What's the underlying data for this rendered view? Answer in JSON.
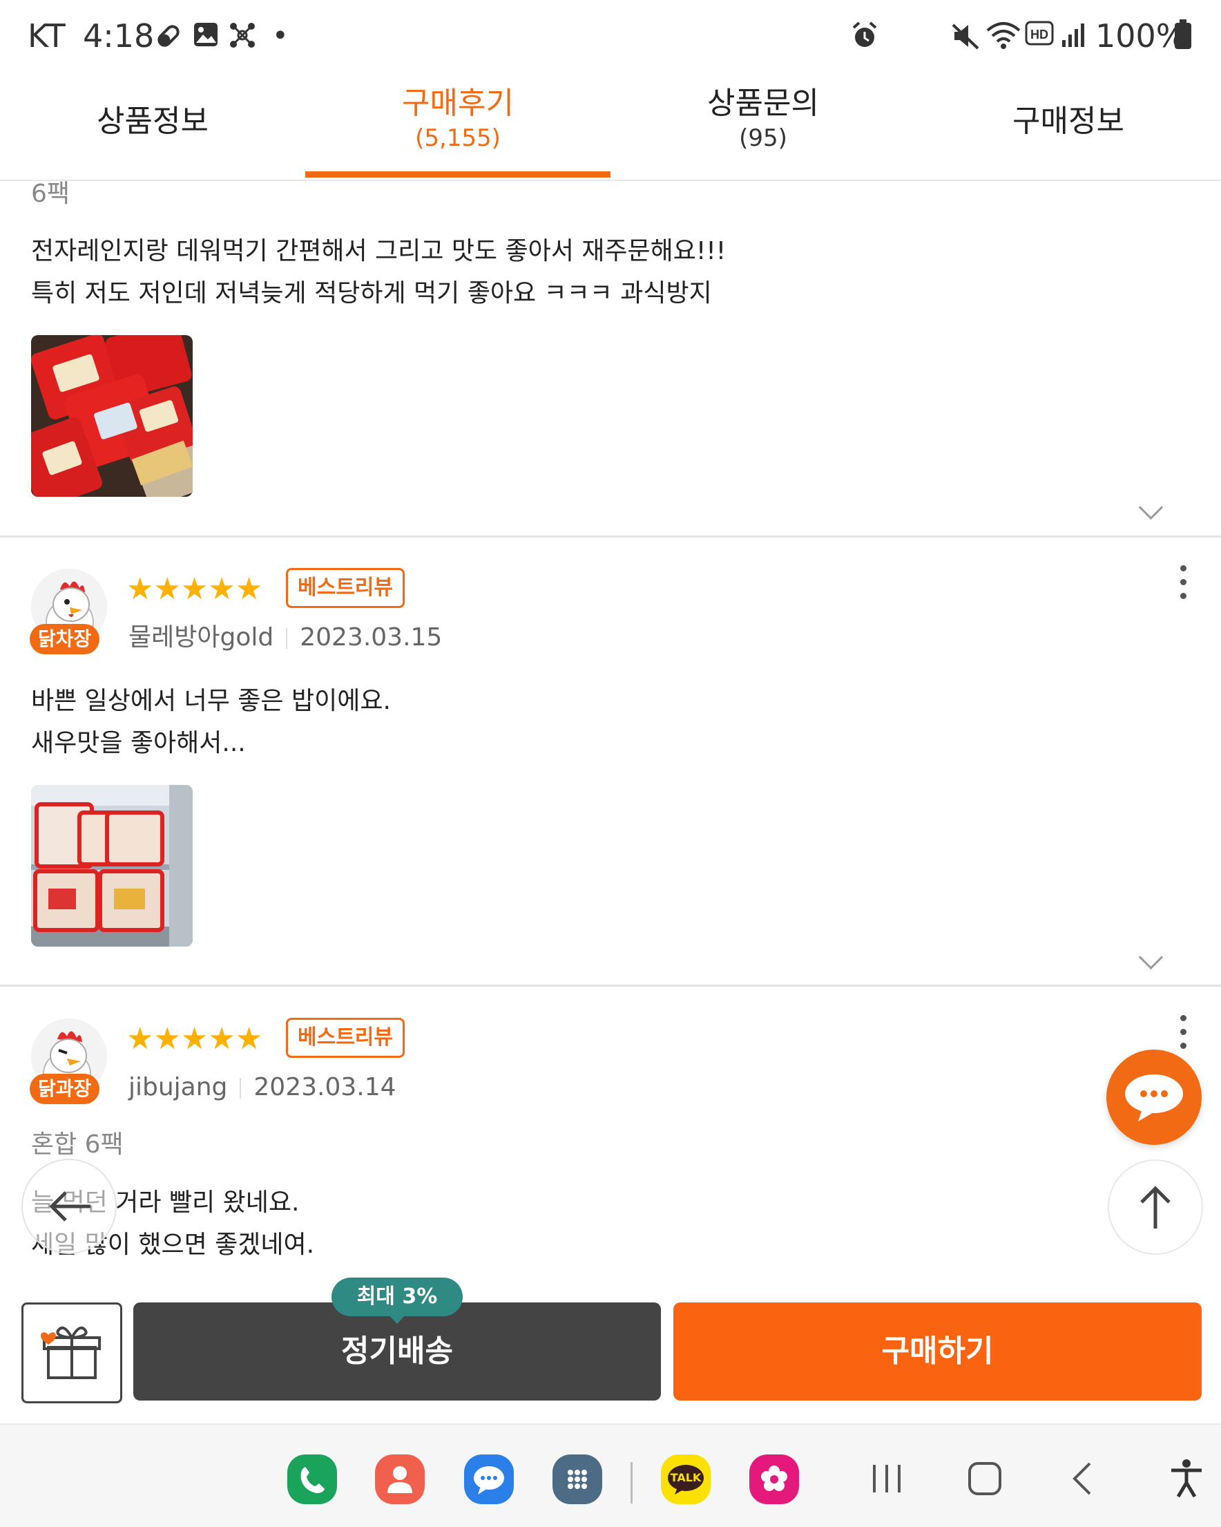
{
  "status_bar": {
    "carrier": "KT",
    "time": "4:18",
    "dot": "•",
    "battery": "100%"
  },
  "tabs": [
    {
      "label": "상품정보",
      "count": ""
    },
    {
      "label": "구매후기",
      "count": "(5,155)"
    },
    {
      "label": "상품문의",
      "count": "(95)"
    },
    {
      "label": "구매정보",
      "count": ""
    }
  ],
  "reviews": [
    {
      "option": "6팩",
      "text_lines": [
        "전자레인지랑 데워먹기 간편해서 그리고 맛도 좋아서 재주문해요!!!",
        "특히 저도 저인데 저녁늦게 적당하게 먹기 좋아요 ㅋㅋㅋ 과식방지"
      ]
    },
    {
      "grade": "닭차장",
      "stars": "★★★★★",
      "badge": "베스트리뷰",
      "username": "물레방아gold",
      "date": "2023.03.15",
      "text_lines": [
        "바쁜 일상에서 너무 좋은 밥이에요.",
        "새우맛을 좋아해서..."
      ]
    },
    {
      "grade": "닭과장",
      "stars": "★★★★★",
      "badge": "베스트리뷰",
      "username": "jibujang",
      "date": "2023.03.14",
      "option": "혼합 6팩",
      "text_lines": [
        "늘 먹던 거라 빨리 왔네요.",
        "세일 많이 했으면 좋겠네여."
      ]
    }
  ],
  "bottom_bar": {
    "tooltip": "최대 3%",
    "subscribe_label": "정기배송",
    "buy_label": "구매하기"
  },
  "nav_apps": [
    {
      "name": "phone-app-icon",
      "color": "#1aa35a"
    },
    {
      "name": "contacts-app-icon",
      "color": "#f0604d"
    },
    {
      "name": "messages-app-icon",
      "color": "#2b7fe8"
    },
    {
      "name": "app-drawer-icon",
      "color": "#4e6b86"
    },
    {
      "name": "kakaotalk-app-icon",
      "color": "#fae100",
      "text": "TALK"
    },
    {
      "name": "gallery-app-icon",
      "color": "#e5197b"
    }
  ],
  "colors": {
    "accent": "#f26a13",
    "subscribe_button": "#444444",
    "buy_button": "#fa6411",
    "tooltip": "#2f8a83",
    "stars": "#ffb000"
  }
}
